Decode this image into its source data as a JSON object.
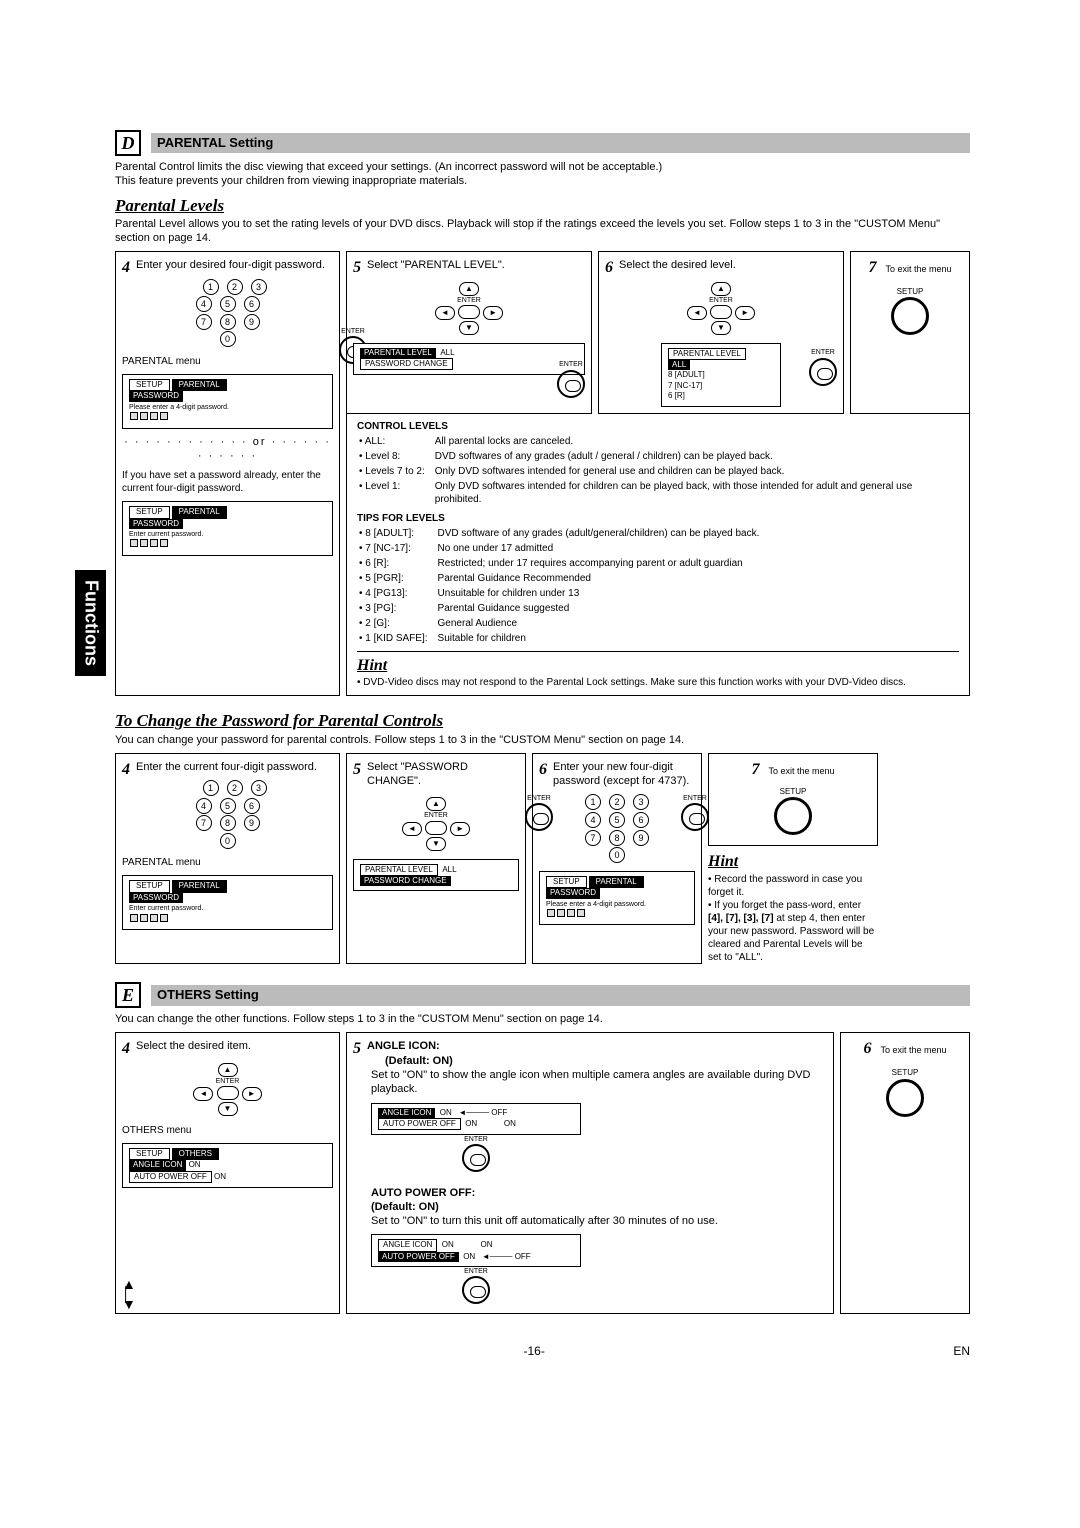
{
  "sideTab": "Functions",
  "sectionD": {
    "letter": "D",
    "title": "PARENTAL Setting",
    "intro1": "Parental Control limits the disc viewing that exceed your settings. (An incorrect password will not be acceptable.)",
    "intro2": "This feature prevents your children from viewing inappropriate materials.",
    "levelsTitle": "Parental Levels",
    "levelsIntro": "Parental Level allows you to set the rating levels of your DVD discs. Playback will stop if the ratings exceed the levels you set. Follow steps 1 to 3 in the \"CUSTOM Menu\" section on page 14.",
    "step4": "Enter your desired four-digit password.",
    "parentalMenuLabel": "PARENTAL menu",
    "orLabel": "or",
    "alreadyPasswordNote": "If you have set a password already, enter the current four-digit password.",
    "step5": "Select \"PARENTAL LEVEL\".",
    "step6": "Select the desired level.",
    "step7": "To exit the menu",
    "enterLabel": "ENTER",
    "setupLabel": "SETUP",
    "osd": {
      "setupTab": "SETUP",
      "parentalTab": "PARENTAL",
      "passwordLabel": "PASSWORD",
      "enterPrompt": "Please enter a 4-digit password.",
      "enterCurrentPrompt": "Enter current password.",
      "parentalLevel": "PARENTAL LEVEL",
      "passwordChange": "PASSWORD CHANGE",
      "allValue": "ALL",
      "dropdown": [
        "ALL",
        "8 [ADULT]",
        "7 [NC-17]",
        "6 [R]"
      ]
    },
    "controlLevels": {
      "heading": "CONTROL LEVELS",
      "rows": [
        {
          "k": "ALL:",
          "v": "All parental locks are canceled."
        },
        {
          "k": "Level 8:",
          "v": "DVD softwares of any grades (adult / general / children) can be played back."
        },
        {
          "k": "Levels 7 to 2:",
          "v": "Only DVD softwares intended for general use and children can be played back."
        },
        {
          "k": "Level 1:",
          "v": "Only DVD softwares intended for children can be played back, with those intended for adult and general use prohibited."
        }
      ]
    },
    "tipsForLevels": {
      "heading": "TIPS FOR LEVELS",
      "rows": [
        {
          "k": "8 [ADULT]:",
          "v": "DVD software of any grades (adult/general/children) can be played back."
        },
        {
          "k": "7 [NC-17]:",
          "v": "No one under 17 admitted"
        },
        {
          "k": "6 [R]:",
          "v": "Restricted; under 17 requires accompanying parent or adult guardian"
        },
        {
          "k": "5 [PGR]:",
          "v": "Parental Guidance Recommended"
        },
        {
          "k": "4 [PG13]:",
          "v": "Unsuitable for children under 13"
        },
        {
          "k": "3 [PG]:",
          "v": "Parental Guidance suggested"
        },
        {
          "k": "2 [G]:",
          "v": "General Audience"
        },
        {
          "k": "1 [KID SAFE]:",
          "v": "Suitable for children"
        }
      ]
    },
    "hint": {
      "title": "Hint",
      "text": "DVD-Video discs may not respond to the Parental Lock settings. Make sure this function works with your DVD-Video discs."
    }
  },
  "changePassword": {
    "title": "To Change the Password for Parental Controls",
    "intro": "You can change your password for parental controls.  Follow steps 1 to 3 in the \"CUSTOM Menu\" section on page 14.",
    "step4": "Enter the current four-digit password.",
    "step5": "Select \"PASSWORD CHANGE\".",
    "step6": "Enter your new four-digit password (except for 4737).",
    "step7": "To exit the menu",
    "parentalMenuLabel": "PARENTAL menu",
    "hint": {
      "title": "Hint",
      "line1": "Record the password in case you forget it.",
      "line2a": "If you forget the pass-word, enter ",
      "line2b": "[4], [7], [3], [7]",
      "line2c": " at step 4, then enter your new password. Password will be cleared and Parental Levels will be set to \"ALL\"."
    }
  },
  "sectionE": {
    "letter": "E",
    "title": "OTHERS Setting",
    "intro": "You can change the other functions. Follow steps 1 to 3 in the \"CUSTOM Menu\" section on page 14.",
    "step4": "Select the desired item.",
    "othersMenuLabel": "OTHERS menu",
    "step5": {
      "angleTitle": "ANGLE ICON:",
      "default": "(Default: ON)",
      "angleDesc": "Set to \"ON\" to show the angle icon when multiple camera angles are available during DVD playback.",
      "autoTitle": "AUTO POWER OFF:",
      "autoDesc": "Set to \"ON\" to turn this unit off automatically after 30 minutes of no use."
    },
    "step6": "To exit the menu",
    "osd": {
      "othersTab": "OTHERS",
      "angleIcon": "ANGLE ICON",
      "autoPowerOff": "AUTO POWER OFF",
      "on": "ON",
      "off": "OFF"
    }
  },
  "footer": {
    "page": "-16-",
    "lang": "EN"
  }
}
